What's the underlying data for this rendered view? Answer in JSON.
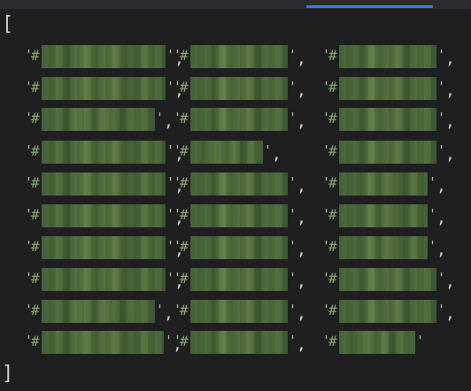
{
  "editor": {
    "open_bracket": "[",
    "close_bracket": "]",
    "quote": "'",
    "hash": "#",
    "comma": ",",
    "redacted_color_entries": 30,
    "columns": 3,
    "rows": 10
  },
  "colors": {
    "background": "#1f1f21",
    "tab_indicator": "#3f7fd8",
    "string": "#a5c08a",
    "redaction": "#4b6e33"
  }
}
